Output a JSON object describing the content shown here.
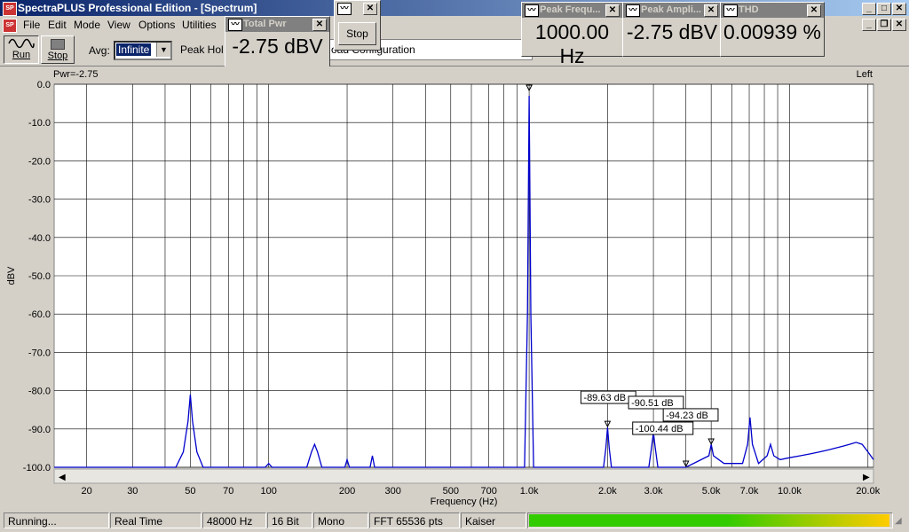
{
  "window": {
    "title": "SpectraPLUS Professional Edition - [Spectrum]"
  },
  "menu": [
    "File",
    "Edit",
    "Mode",
    "View",
    "Options",
    "Utilities"
  ],
  "toolbar": {
    "run_label": "Run",
    "stop_label": "Stop",
    "avg_label": "Avg:",
    "avg_value": "Infinite",
    "peakhold_label": "Peak Hol",
    "config_text": "oad Configuration"
  },
  "meters": {
    "total_pwr": {
      "title": "Total Pwr",
      "value": "-2.75 dBV"
    },
    "stop_window": {
      "button": "Stop"
    },
    "peak_freq": {
      "title": "Peak Frequ...",
      "value": "1000.00 Hz"
    },
    "peak_ampl": {
      "title": "Peak Ampli...",
      "value": "-2.75 dBV"
    },
    "thd": {
      "title": "THD",
      "value": "0.00939 %"
    }
  },
  "plot": {
    "pwr_label": "Pwr=-2.75",
    "channel_label": "Left"
  },
  "chart_data": {
    "type": "line",
    "xlabel": "Frequency (Hz)",
    "ylabel": "dBV",
    "xscale": "log",
    "xlim": [
      15,
      21000
    ],
    "ylim": [
      -100,
      0
    ],
    "grid": true,
    "y_ticks": [
      "0.0",
      "-10.0",
      "-20.0",
      "-30.0",
      "-40.0",
      "-50.0",
      "-60.0",
      "-70.0",
      "-80.0",
      "-90.0",
      "-100.0"
    ],
    "x_ticks": [
      {
        "f": 20,
        "label": "20"
      },
      {
        "f": 30,
        "label": "30"
      },
      {
        "f": 50,
        "label": "50"
      },
      {
        "f": 70,
        "label": "70"
      },
      {
        "f": 100,
        "label": "100"
      },
      {
        "f": 200,
        "label": "200"
      },
      {
        "f": 300,
        "label": "300"
      },
      {
        "f": 500,
        "label": "500"
      },
      {
        "f": 700,
        "label": "700"
      },
      {
        "f": 1000,
        "label": "1.0k"
      },
      {
        "f": 2000,
        "label": "2.0k"
      },
      {
        "f": 3000,
        "label": "3.0k"
      },
      {
        "f": 5000,
        "label": "5.0k"
      },
      {
        "f": 7000,
        "label": "7.0k"
      },
      {
        "f": 10000,
        "label": "10.0k"
      },
      {
        "f": 20000,
        "label": "20.0k"
      }
    ],
    "series": [
      {
        "color": "#0000cc",
        "x": [
          15,
          44,
          47,
          49,
          50,
          51,
          53,
          56,
          97,
          100,
          103,
          140,
          146,
          150,
          154,
          160,
          196,
          200,
          204,
          245,
          250,
          255,
          900,
          960,
          985,
          1000,
          1015,
          1040,
          1100,
          1930,
          1970,
          2000,
          2030,
          2070,
          2880,
          2950,
          3000,
          3050,
          3120,
          4000,
          4900,
          5000,
          5100,
          5600,
          6600,
          6900,
          7050,
          7200,
          7600,
          8200,
          8450,
          8700,
          9200,
          10000,
          11000,
          12000,
          13000,
          14000,
          15000,
          16000,
          17000,
          18000,
          19000,
          20000,
          21000
        ],
        "y": [
          -100,
          -100,
          -96,
          -88,
          -81,
          -88,
          -96,
          -100,
          -100,
          -99,
          -100,
          -100,
          -96,
          -94,
          -96,
          -100,
          -100,
          -98,
          -100,
          -100,
          -97,
          -100,
          -100,
          -100,
          -60,
          -3,
          -60,
          -100,
          -100,
          -100,
          -95,
          -89.6,
          -95,
          -100,
          -100,
          -95,
          -91,
          -95,
          -100,
          -100,
          -97,
          -94,
          -97,
          -99,
          -99,
          -94,
          -87,
          -94,
          -99,
          -97,
          -94,
          -97,
          -98,
          -97.5,
          -97,
          -96.5,
          -96,
          -95.5,
          -95,
          -94.5,
          -94,
          -93.5,
          -94,
          -96,
          -98
        ]
      }
    ],
    "annotations": [
      {
        "label": "-89.63 dB",
        "f": 2000,
        "db": -89.6
      },
      {
        "label": "-90.51 dB",
        "f": 3000,
        "db": -90.5
      },
      {
        "label": "-100.44 dB",
        "f": 4000,
        "db": -100.4
      },
      {
        "label": "-94.23 dB",
        "f": 5000,
        "db": -94.2
      }
    ]
  },
  "status": {
    "state": "Running...",
    "mode": "Real Time",
    "rate": "48000 Hz",
    "bits": "16 Bit",
    "channels": "Mono",
    "fft": "FFT 65536 pts",
    "window_fn": "Kaiser"
  },
  "level_meter": {
    "level": 0.99,
    "colors": [
      "#33cc00",
      "#ffcc00"
    ]
  }
}
